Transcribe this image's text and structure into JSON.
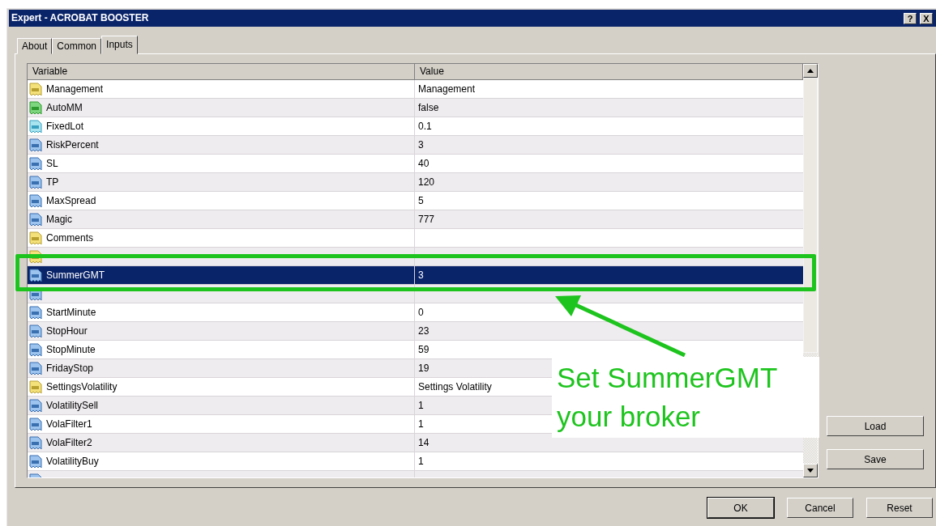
{
  "window": {
    "title": "Expert - ACROBAT BOOSTER",
    "title_buttons": [
      "?",
      "X"
    ]
  },
  "tabs": [
    {
      "label": "About",
      "selected": false
    },
    {
      "label": "Common",
      "selected": false
    },
    {
      "label": "Inputs",
      "selected": true
    }
  ],
  "table": {
    "columns": [
      "Variable",
      "Value"
    ],
    "rows": [
      {
        "kind": "text",
        "variable": "Management",
        "value": "Management",
        "selected": false
      },
      {
        "kind": "bool",
        "variable": "AutoMM",
        "value": "false",
        "selected": false
      },
      {
        "kind": "double",
        "variable": "FixedLot",
        "value": "0.1",
        "selected": false
      },
      {
        "kind": "int",
        "variable": "RiskPercent",
        "value": "3",
        "selected": false
      },
      {
        "kind": "int",
        "variable": "SL",
        "value": "40",
        "selected": false
      },
      {
        "kind": "int",
        "variable": "TP",
        "value": "120",
        "selected": false
      },
      {
        "kind": "int",
        "variable": "MaxSpread",
        "value": "5",
        "selected": false
      },
      {
        "kind": "int",
        "variable": "Magic",
        "value": "777",
        "selected": false
      },
      {
        "kind": "text",
        "variable": "Comments",
        "value": "",
        "selected": false
      },
      {
        "kind": "text",
        "selected": false
      },
      {
        "kind": "int",
        "variable": "SummerGMT",
        "value": "3",
        "selected": true
      },
      {
        "kind": "int",
        "selected": false
      },
      {
        "kind": "int",
        "variable": "StartMinute",
        "value": "0",
        "selected": false
      },
      {
        "kind": "int",
        "variable": "StopHour",
        "value": "23",
        "selected": false
      },
      {
        "kind": "int",
        "variable": "StopMinute",
        "value": "59",
        "selected": false
      },
      {
        "kind": "int",
        "variable": "FridayStop",
        "value": "19",
        "selected": false
      },
      {
        "kind": "text",
        "variable": "SettingsVolatility",
        "value": "Settings Volatility",
        "selected": false
      },
      {
        "kind": "int",
        "variable": "VolatilitySell",
        "value": "1",
        "selected": false
      },
      {
        "kind": "int",
        "variable": "VolaFilter1",
        "value": "1",
        "selected": false
      },
      {
        "kind": "int",
        "variable": "VolaFilter2",
        "value": "14",
        "selected": false
      },
      {
        "kind": "int",
        "variable": "VolatilityBuy",
        "value": "1",
        "selected": false
      },
      {
        "kind": "int",
        "selected": false
      }
    ]
  },
  "side_buttons": [
    "Load",
    "Save"
  ],
  "footer_buttons": [
    {
      "label": "OK",
      "default": true
    },
    {
      "label": "Cancel",
      "default": false
    },
    {
      "label": "Reset",
      "default": false
    }
  ],
  "annotation": {
    "text": "Set SummerGMT\nyour broker"
  }
}
